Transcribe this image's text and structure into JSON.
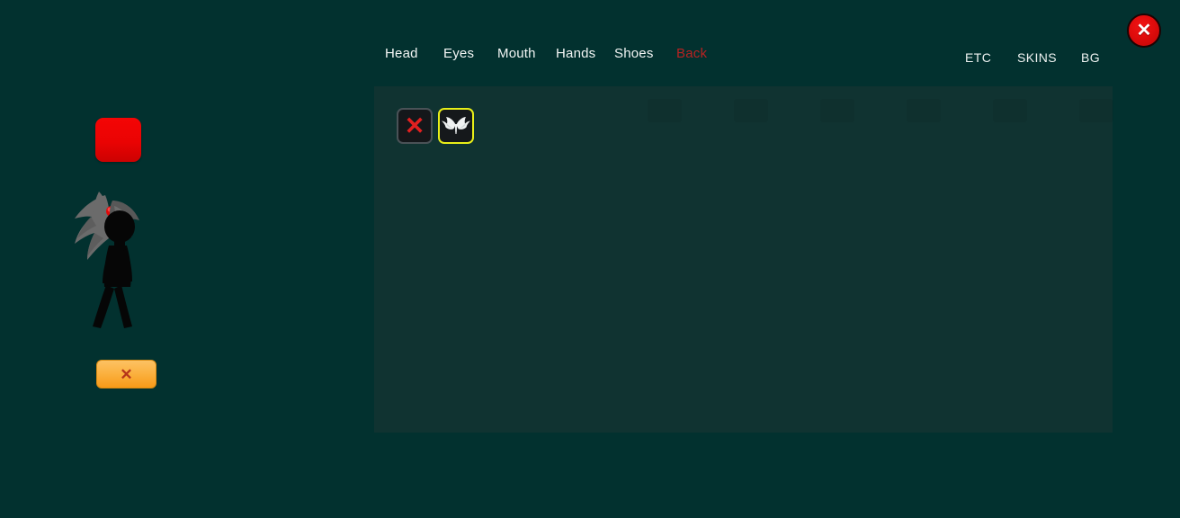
{
  "window": {
    "background_color": "#02312f",
    "panel_color": "#103331"
  },
  "top_nav": {
    "tabs": [
      {
        "label": "Head",
        "active": false
      },
      {
        "label": "Eyes",
        "active": false
      },
      {
        "label": "Mouth",
        "active": false
      },
      {
        "label": "Hands",
        "active": false
      },
      {
        "label": "Shoes",
        "active": false
      },
      {
        "label": "Back",
        "active": true
      }
    ],
    "active_tab": "Back",
    "active_color": "#b82222",
    "inactive_color": "#f2f5f4"
  },
  "side_buttons": [
    {
      "label": "ETC"
    },
    {
      "label": "SKINS"
    },
    {
      "label": "BG"
    }
  ],
  "close_button": {
    "icon": "close-x-icon",
    "glyph": "✕",
    "color": "#e00c0c"
  },
  "item_panel": {
    "category": "Back",
    "slots": [
      {
        "icon": "none-x-icon",
        "label": "None",
        "selected": false,
        "glyph": "✕"
      },
      {
        "icon": "angel-wings-icon",
        "label": "Wings",
        "selected": true,
        "highlight_color": "#e8ef18"
      }
    ]
  },
  "preview": {
    "color_swatch": {
      "name": "Red",
      "color": "#ea0303"
    },
    "character": {
      "name": "stick-figure-avatar",
      "body_color": "#060606",
      "hair_color": "#6e6e6e",
      "hair_accent_color": "#e00a0a"
    },
    "action_button": {
      "icon": "clear-x-icon",
      "glyph": "✕",
      "color": "#fbb13f"
    }
  }
}
